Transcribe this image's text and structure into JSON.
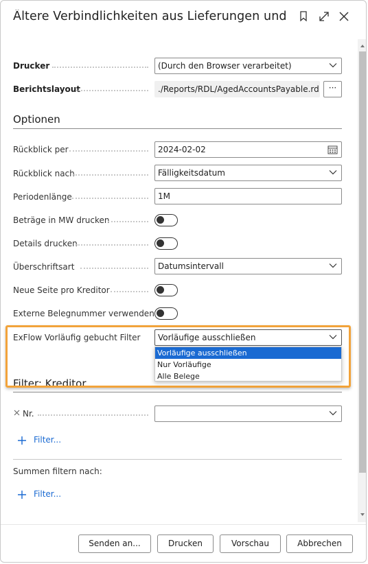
{
  "dialog": {
    "title": "Ältere Verbindlichkeiten aus Lieferungen und L...",
    "header_icons": [
      "bookmark-icon",
      "expand-icon",
      "close-icon"
    ]
  },
  "printer": {
    "label": "Drucker",
    "value": "(Durch den Browser verarbeitet)"
  },
  "report_layout": {
    "label": "Berichtslayout",
    "value": "./Reports/RDL/AgedAccountsPayable.rdl",
    "button_label": "···"
  },
  "options": {
    "title": "Optionen",
    "aged_as_of": {
      "label": "Rückblick per",
      "value": "2024-02-02"
    },
    "aging_by": {
      "label": "Rückblick nach",
      "value": "Fälligkeitsdatum"
    },
    "period_length": {
      "label": "Periodenlänge",
      "value": "1M"
    },
    "amounts_lcy": {
      "label": "Beträge in MW drucken",
      "on": false
    },
    "print_details": {
      "label": "Details drucken",
      "on": false
    },
    "heading_type": {
      "label": "Überschriftsart",
      "value": "Datumsintervall"
    },
    "new_page_per_vendor": {
      "label": "Neue Seite pro Kreditor",
      "on": false
    },
    "external_doc_no": {
      "label": "Externe Belegnummer verwenden",
      "on": false
    },
    "exflow_filter": {
      "label": "ExFlow Vorläufig gebucht Filter",
      "value": "Vorläufige ausschließen",
      "options": [
        "Vorläufige ausschließen",
        "Nur Vorläufige",
        "Alle Belege"
      ],
      "selected_index": 0
    }
  },
  "filter_vendor": {
    "title": "Filter: Kreditor",
    "no_label": "Nr.",
    "no_value": "",
    "add_filter_label": "Filter..."
  },
  "totals_filter": {
    "title": "Summen filtern nach:",
    "add_filter_label": "Filter..."
  },
  "footer": {
    "send_label": "Senden an...",
    "print_label": "Drucken",
    "preview_label": "Vorschau",
    "cancel_label": "Abbrechen"
  },
  "colors": {
    "accent": "#1a6ad2",
    "highlight": "#f2a33a",
    "text": "#212121",
    "border": "#8a8a8a"
  }
}
